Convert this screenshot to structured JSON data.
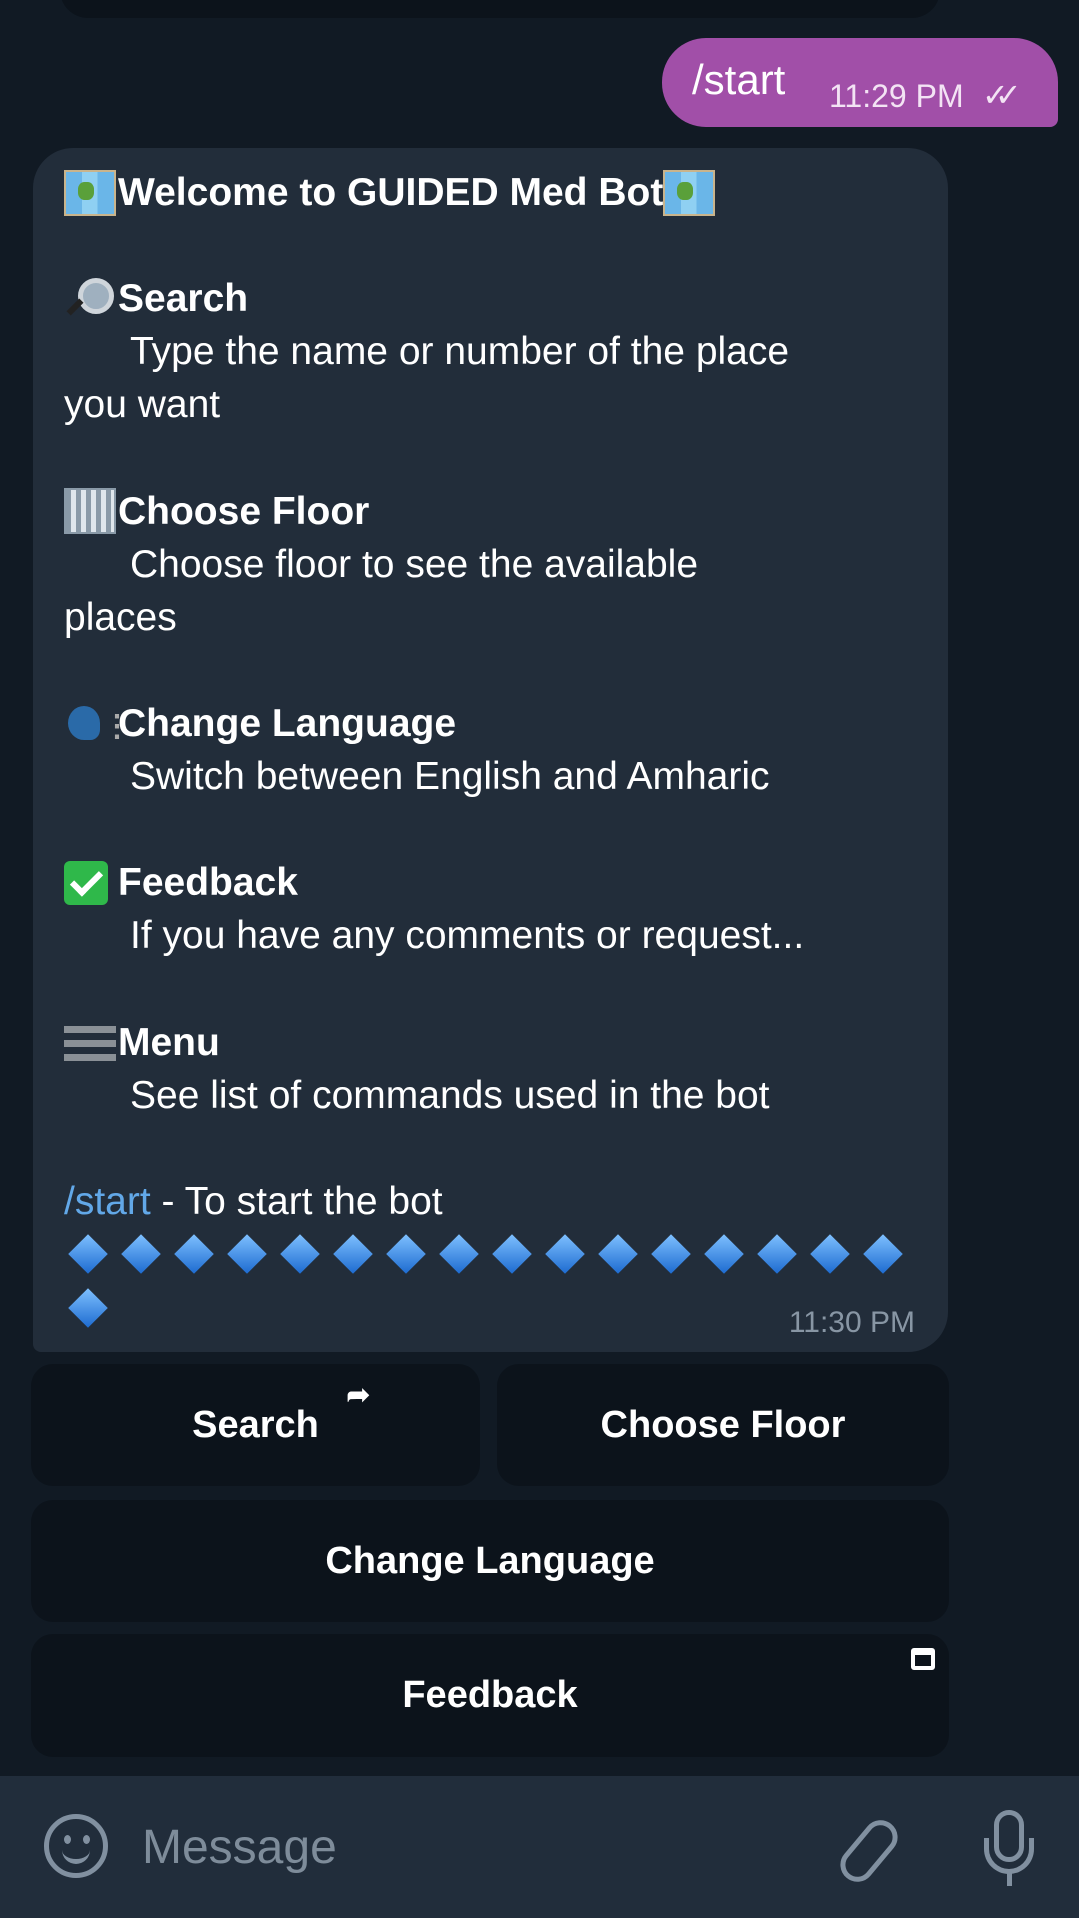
{
  "user_message": {
    "text": "/start",
    "time": "11:29 PM",
    "status_icon": "double-check-icon"
  },
  "bot_message": {
    "title": "Welcome to GUIDED Med Bot",
    "title_icon": "world-map-emoji",
    "sections": [
      {
        "icon": "magnifier-emoji",
        "heading": "Search",
        "lines": [
          "Type the name or number of the place",
          "you want"
        ]
      },
      {
        "icon": "office-building-emoji",
        "heading": "Choose Floor",
        "lines": [
          "Choose floor to see the available",
          "places"
        ]
      },
      {
        "icon": "speaking-head-emoji",
        "heading": "Change Language",
        "lines": [
          "Switch between English and Amharic"
        ]
      },
      {
        "icon": "check-mark-button-emoji",
        "heading": "Feedback",
        "lines": [
          "If you have any comments or request..."
        ]
      },
      {
        "icon": "menu-bars-emoji",
        "heading": "Menu",
        "lines": [
          "See list of commands used in the bot"
        ]
      }
    ],
    "command": "/start",
    "command_desc": " - To start the bot",
    "diamond_icon": "small-blue-diamond-emoji",
    "diamond_count": 17,
    "time": "11:30 PM"
  },
  "keyboard": {
    "search": "Search",
    "choose_floor": "Choose Floor",
    "change_language": "Change Language",
    "feedback": "Feedback"
  },
  "input": {
    "placeholder": "Message"
  },
  "colors": {
    "background": "#111a24",
    "user_bubble": "#a14fa8",
    "bot_bubble": "#222d3a",
    "link": "#62a8e8",
    "button": "#0c131b"
  }
}
